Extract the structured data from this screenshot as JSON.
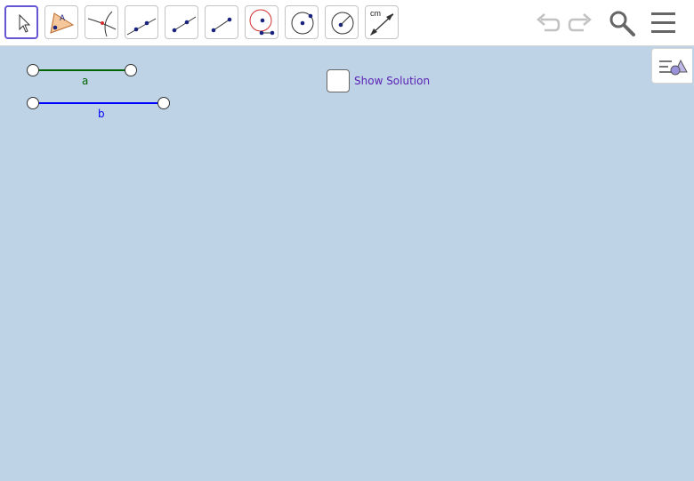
{
  "toolbar": {
    "tools": [
      {
        "name": "move-tool-icon",
        "selected": true
      },
      {
        "name": "polygon-tool-icon",
        "text": "A"
      },
      {
        "name": "intersect-tool-icon"
      },
      {
        "name": "line-tool-icon"
      },
      {
        "name": "ray-tool-icon"
      },
      {
        "name": "segment-tool-icon"
      },
      {
        "name": "compass-tool-icon"
      },
      {
        "name": "circle-center-point-icon"
      },
      {
        "name": "circle-center-radius-icon"
      },
      {
        "name": "distance-tool-icon",
        "text": "cm"
      }
    ],
    "right_buttons": [
      "undo-icon",
      "redo-icon",
      "search-icon",
      "menu-icon"
    ]
  },
  "canvas": {
    "segments": [
      {
        "label": "a",
        "color": "#006400"
      },
      {
        "label": "b",
        "color": "#0000ff"
      }
    ],
    "checkbox": {
      "label": "Show Solution",
      "checked": false,
      "label_color": "#5b22b4"
    }
  },
  "colors": {
    "background": "#bed4e6",
    "point_dark": "#1a237e",
    "accent": "#6557d2",
    "compass_red": "#d32f2f"
  }
}
